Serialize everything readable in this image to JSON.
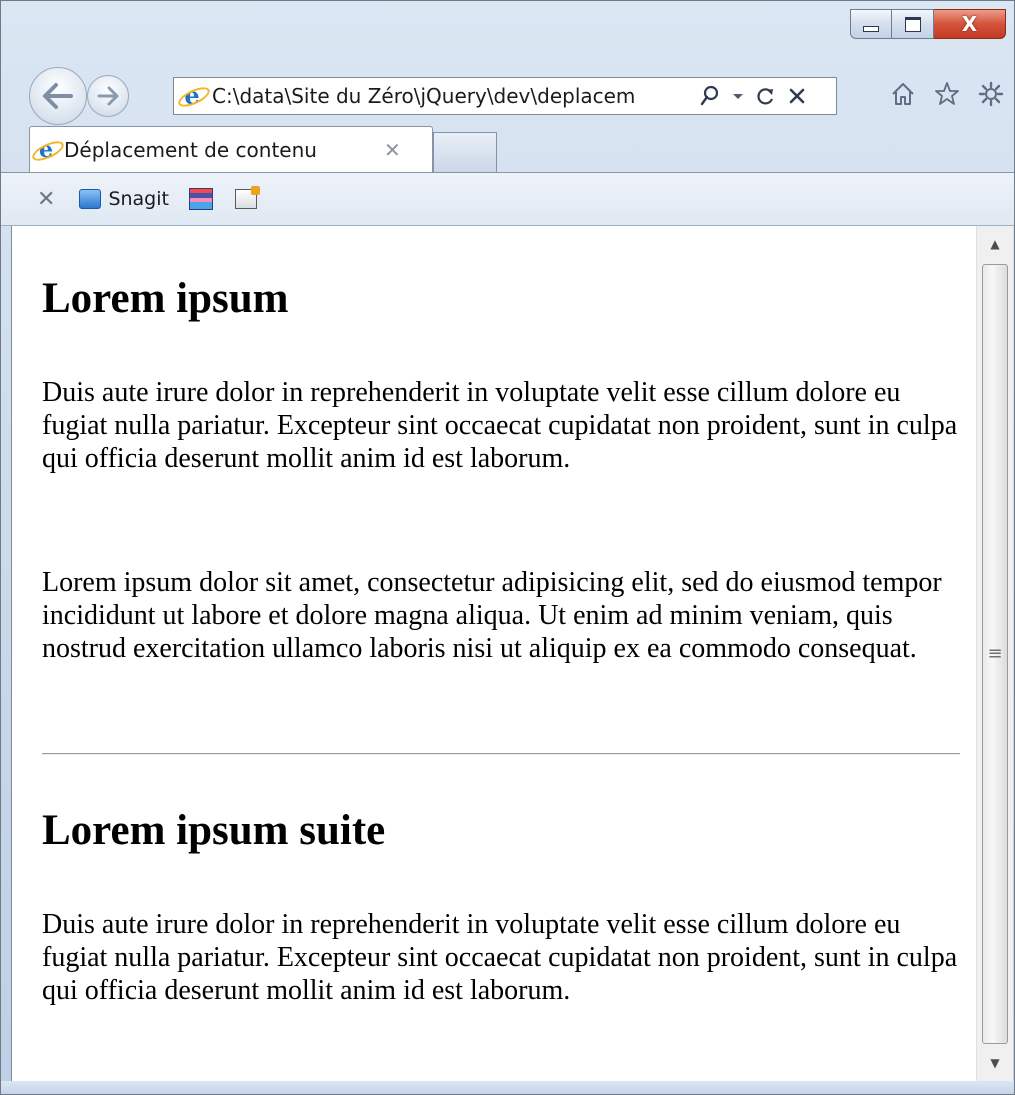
{
  "browser": {
    "address": "C:\\data\\Site du Zéro\\jQuery\\dev\\deplacem",
    "tab_title": "Déplacement de contenu",
    "toolbar_snagit": "Snagit"
  },
  "window_controls": {
    "close_symbol": "X"
  },
  "icons": {
    "back": "back-arrow-icon",
    "forward": "forward-arrow-icon",
    "search": "search-icon",
    "dropdown": "chevron-down-icon",
    "refresh": "refresh-icon",
    "stop": "stop-icon",
    "home": "home-icon",
    "favorites": "star-icon",
    "tools": "gear-icon"
  },
  "page": {
    "heading1": "Lorem ipsum",
    "para1": "Duis aute irure dolor in reprehenderit in voluptate velit esse cillum dolore eu fugiat nulla pariatur. Excepteur sint occaecat cupidatat non proident, sunt in culpa qui officia deserunt mollit anim id est laborum.",
    "para2": "Lorem ipsum dolor sit amet, consectetur adipisicing elit, sed do eiusmod tempor incididunt ut labore et dolore magna aliqua. Ut enim ad minim veniam, quis nostrud exercitation ullamco laboris nisi ut aliquip ex ea commodo consequat.",
    "heading2": "Lorem ipsum suite",
    "para3": "Duis aute irure dolor in reprehenderit in voluptate velit esse cillum dolore eu fugiat nulla pariatur. Excepteur sint occaecat cupidatat non proident, sunt in culpa qui officia deserunt mollit anim id est laborum."
  },
  "scrollbar": {
    "position_fraction": 0.0
  }
}
